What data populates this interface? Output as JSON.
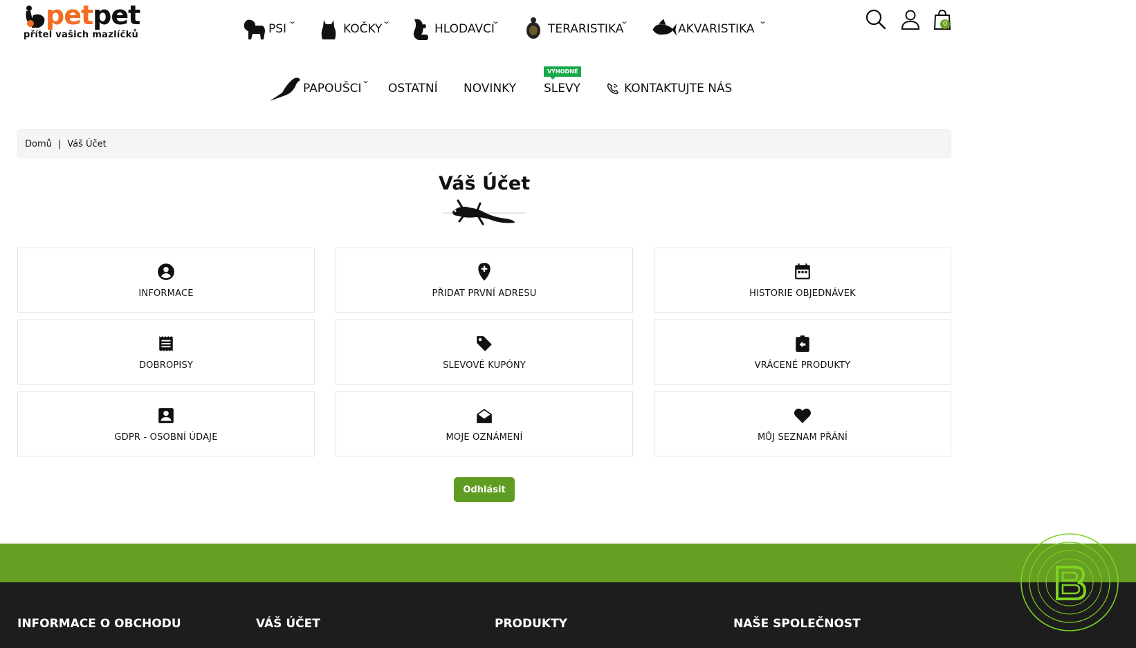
{
  "logo": {
    "part1": "pet",
    "part2": "pet",
    "tagline": "přítel vašich mazlíčků"
  },
  "nav": {
    "row1": [
      {
        "label": "PSI"
      },
      {
        "label": "KOČKY"
      },
      {
        "label": "HLODAVCI"
      },
      {
        "label": "TERARISTIKA"
      },
      {
        "label": "AKVARISTIKA"
      }
    ],
    "row2": [
      {
        "label": "PAPOUŠCI"
      },
      {
        "label": "OSTATNÍ"
      },
      {
        "label": "NOVINKY"
      },
      {
        "label": "SLEVY"
      },
      {
        "label": "KONTAKTUJTE NÁS"
      }
    ],
    "badge": "VÝHODNÉ"
  },
  "header": {
    "cart_count": "0"
  },
  "breadcrumb": {
    "home": "Domů",
    "separator": "|",
    "current": "Váš Účet"
  },
  "page_title": "Váš Účet",
  "account_links": [
    {
      "label": "INFORMACE",
      "icon": "account-circle-icon"
    },
    {
      "label": "PŘIDAT PRVNÍ ADRESU",
      "icon": "add-location-icon"
    },
    {
      "label": "HISTORIE OBJEDNÁVEK",
      "icon": "calendar-icon"
    },
    {
      "label": "DOBROPISY",
      "icon": "receipt-icon"
    },
    {
      "label": "SLEVOVÉ KUPÓNY",
      "icon": "tag-icon"
    },
    {
      "label": "VRÁCENÉ PRODUKTY",
      "icon": "return-icon"
    },
    {
      "label": "GDPR - OSOBNÍ ÚDAJE",
      "icon": "contact-card-icon"
    },
    {
      "label": "MOJE OZNÁMENÍ",
      "icon": "mail-open-icon"
    },
    {
      "label": "MŮJ SEZNAM PŘÁNÍ",
      "icon": "heart-icon"
    }
  ],
  "logout_label": "Odhlásit",
  "footer": {
    "columns": [
      "INFORMACE O OBCHODU",
      "VÁŠ ÚČET",
      "PRODUKTY",
      "NAŠE SPOLEČNOST"
    ]
  },
  "colors": {
    "accent": "#669f22",
    "brand_orange": "#f26d21",
    "footer_dark": "#1d1d1d",
    "badge_green": "#18a84a"
  }
}
